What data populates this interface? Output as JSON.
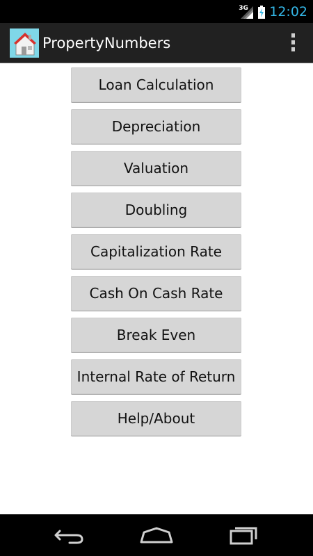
{
  "status_bar": {
    "network_type": "3G",
    "time": "12:02",
    "icons": [
      "signal-icon",
      "battery-charging-icon"
    ],
    "accent_color": "#33b5e5"
  },
  "action_bar": {
    "title": "PropertyNumbers",
    "app_icon": "house-icon",
    "menu_icon": "overflow-menu-icon"
  },
  "menu": {
    "items": [
      {
        "label": "Loan Calculation"
      },
      {
        "label": "Depreciation"
      },
      {
        "label": "Valuation"
      },
      {
        "label": "Doubling"
      },
      {
        "label": "Capitalization Rate"
      },
      {
        "label": "Cash On Cash Rate"
      },
      {
        "label": "Break Even"
      },
      {
        "label": "Internal Rate of Return"
      },
      {
        "label": "Help/About"
      }
    ]
  },
  "nav_bar": {
    "icons": [
      "back-icon",
      "home-icon",
      "recent-apps-icon"
    ]
  }
}
